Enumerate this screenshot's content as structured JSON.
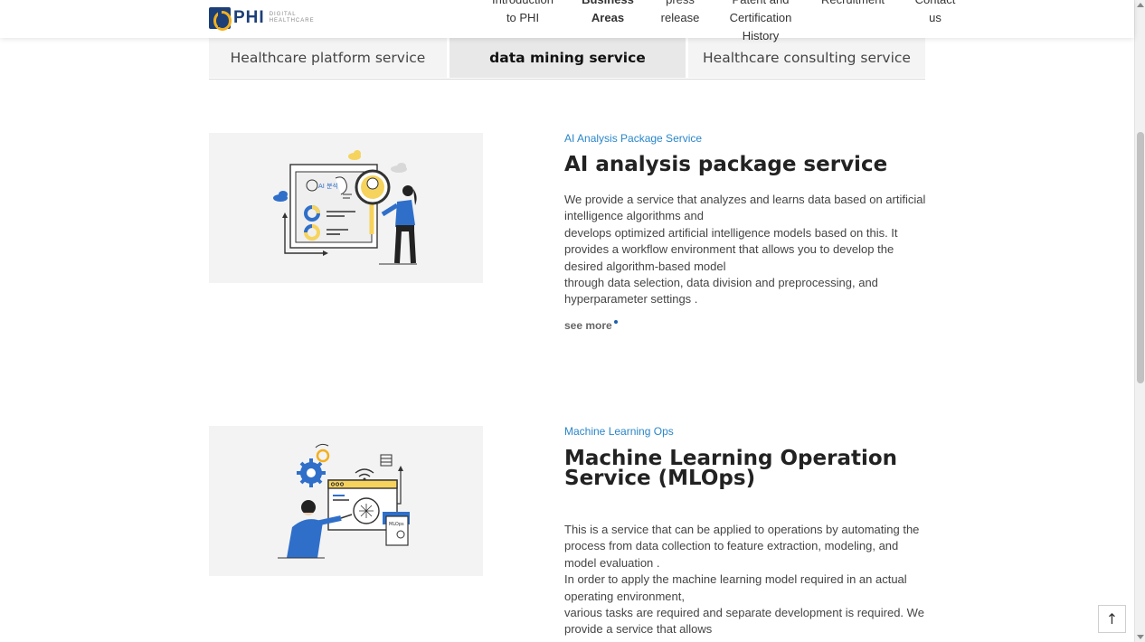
{
  "brand": {
    "logo_text": "PHI",
    "logo_sub_1": "DIGITAL",
    "logo_sub_2": "HEALTHCARE"
  },
  "nav": {
    "introduction": {
      "line1": "Introduction",
      "line2": "to PHI"
    },
    "business": {
      "line1": "Business",
      "line2": "Areas"
    },
    "press": {
      "line1": "press",
      "line2": "release"
    },
    "patent": {
      "line1": "Patent and",
      "line2": "Certification",
      "line3": "History"
    },
    "recruitment": {
      "line1": "Recruitment"
    },
    "contact": {
      "line1": "Contact",
      "line2": "us"
    }
  },
  "tabs": [
    {
      "label": "Healthcare platform service",
      "active": false
    },
    {
      "label": "data mining service",
      "active": true
    },
    {
      "label": "Healthcare consulting service",
      "active": false
    }
  ],
  "sections": [
    {
      "tag": "AI Analysis Package Service",
      "title": "AI analysis package service",
      "illustration_label": "AI 분석",
      "desc": [
        "We provide a service that analyzes and learns data based on artificial intelligence algorithms and",
        "develops optimized artificial intelligence models based on this. It provides a workflow environment that allows you to develop the desired algorithm-based model",
        "through data selection, data division and preprocessing, and hyperparameter settings ."
      ],
      "see_more": "see more"
    },
    {
      "tag": "Machine Learning Ops",
      "title": "Machine Learning Operation Service (MLOps)",
      "illustration_label": "MLOps",
      "desc": [
        "This is a service that can be applied to operations by automating the process from data collection to feature extraction, modeling, and model evaluation .",
        "In order to apply the machine learning model required in an actual operating environment,",
        "various tasks are required and separate development is required. We provide a service that allows"
      ]
    }
  ],
  "top_button": "↑",
  "colors": {
    "brand_navy": "#1c3f78",
    "brand_yellow": "#f2b01e",
    "accent_blue": "#2a86c9",
    "illustration_blue": "#2f6fc9"
  }
}
